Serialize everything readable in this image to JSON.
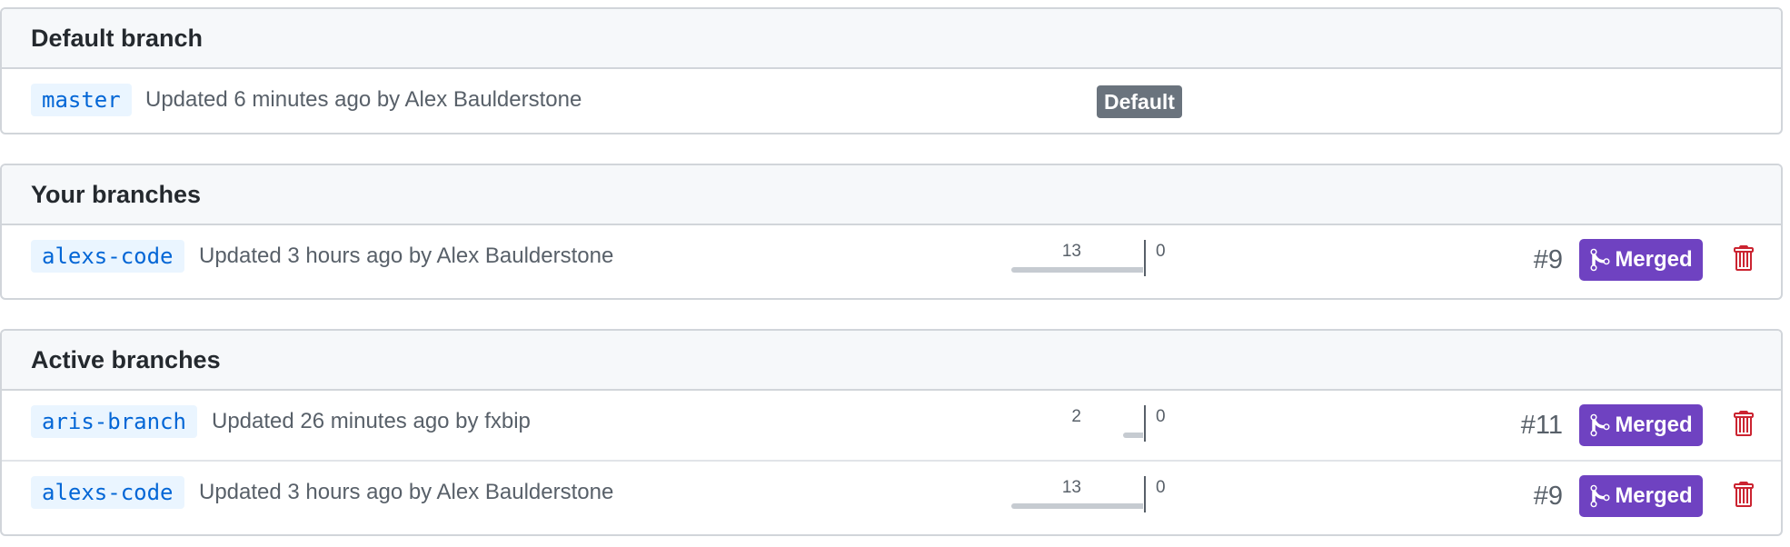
{
  "default_section": {
    "title": "Default branch",
    "rows": [
      {
        "branch": "master",
        "updated": "Updated 6 minutes ago by Alex Baulderstone",
        "badge": "Default"
      }
    ]
  },
  "your_section": {
    "title": "Your branches",
    "rows": [
      {
        "branch": "alexs-code",
        "updated": "Updated 3 hours ago by Alex Baulderstone",
        "behind": "13",
        "ahead": "0",
        "behind_value": 13,
        "pr": "#9",
        "status": "Merged"
      }
    ]
  },
  "active_section": {
    "title": "Active branches",
    "rows": [
      {
        "branch": "aris-branch",
        "updated": "Updated 26 minutes ago by fxbip",
        "behind": "2",
        "ahead": "0",
        "behind_value": 2,
        "pr": "#11",
        "status": "Merged"
      },
      {
        "branch": "alexs-code",
        "updated": "Updated 3 hours ago by Alex Baulderstone",
        "behind": "13",
        "ahead": "0",
        "behind_value": 13,
        "pr": "#9",
        "status": "Merged"
      }
    ]
  },
  "colors": {
    "merged": "#6f42c1",
    "branch_bg": "#eaf5ff",
    "branch_text": "#0366d6",
    "delete": "#cb2431",
    "default_badge": "#6a737d"
  },
  "icons": {
    "merged": "git-merge-icon",
    "delete": "trash-icon"
  }
}
